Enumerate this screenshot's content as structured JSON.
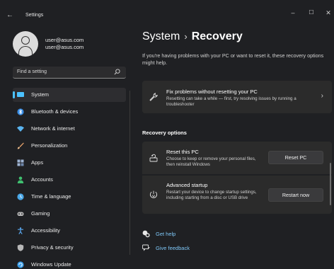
{
  "window": {
    "app_title": "Settings",
    "back_glyph": "←",
    "controls": {
      "minimize": "–",
      "maximize": "☐",
      "close": "✕"
    }
  },
  "profile": {
    "name": "user@asus.com",
    "email": "user@asus.com",
    "avatar_icon": "person-avatar-icon"
  },
  "search": {
    "placeholder": "Find a setting",
    "icon": "search-icon"
  },
  "sidebar": {
    "items": [
      {
        "label": "System",
        "icon": "monitor-icon",
        "color": "#4cc2ff",
        "active": true
      },
      {
        "label": "Bluetooth & devices",
        "icon": "bluetooth-icon",
        "color": "#3a8ee6"
      },
      {
        "label": "Network & internet",
        "icon": "wifi-icon",
        "color": "#5ab4f0"
      },
      {
        "label": "Personalization",
        "icon": "brush-icon",
        "color": "#e9a36a"
      },
      {
        "label": "Apps",
        "icon": "apps-icon",
        "color": "#9fb5d4"
      },
      {
        "label": "Accounts",
        "icon": "accounts-icon",
        "color": "#3fbf6f"
      },
      {
        "label": "Time & language",
        "icon": "globe-clock-icon",
        "color": "#4aa8e8"
      },
      {
        "label": "Gaming",
        "icon": "gamepad-icon",
        "color": "#b8b8b8"
      },
      {
        "label": "Accessibility",
        "icon": "accessibility-icon",
        "color": "#5aa8f0"
      },
      {
        "label": "Privacy & security",
        "icon": "shield-icon",
        "color": "#b8b8b8"
      },
      {
        "label": "Windows Update",
        "icon": "update-icon",
        "color": "#3c9ee8"
      }
    ]
  },
  "main": {
    "breadcrumb": {
      "parent": "System",
      "separator": "›",
      "current": "Recovery"
    },
    "intro": "If you're having problems with your PC or want to reset it, these recovery options might help.",
    "fix_card": {
      "title": "Fix problems without resetting your PC",
      "desc": "Resetting can take a while — first, try resolving issues by running a troubleshooter",
      "icon": "wrench-icon",
      "chevron": "›"
    },
    "section_title": "Recovery options",
    "reset_card": {
      "title": "Reset this PC",
      "desc": "Choose to keep or remove your personal files, then reinstall Windows",
      "button": "Reset PC",
      "icon": "reset-pc-icon"
    },
    "advanced_card": {
      "title": "Advanced startup",
      "desc": "Restart your device to change startup settings, including starting from a disc or USB drive",
      "button": "Restart now",
      "icon": "advanced-startup-icon"
    },
    "links": [
      {
        "label": "Get help",
        "icon": "help-icon"
      },
      {
        "label": "Give feedback",
        "icon": "feedback-icon"
      }
    ]
  },
  "colors": {
    "accent": "#4cc2ff",
    "link": "#7fc8f8",
    "background": "#1f2023",
    "card": "#2b2b2b"
  }
}
